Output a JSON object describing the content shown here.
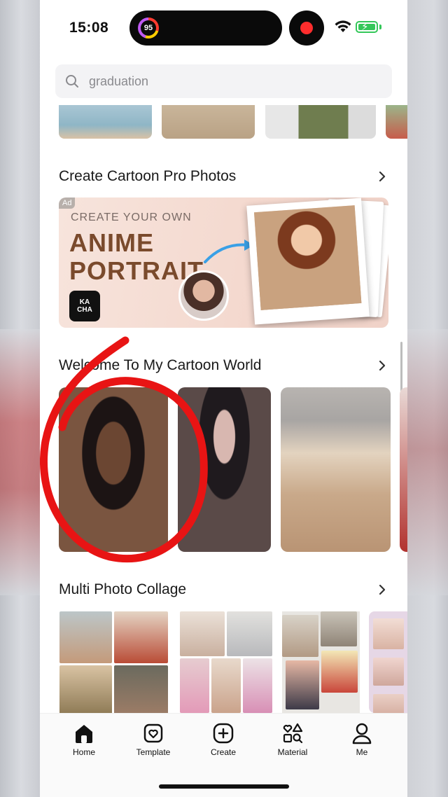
{
  "status": {
    "time": "15:08",
    "activity_badge": "95"
  },
  "search": {
    "query": "graduation"
  },
  "sections": {
    "cartoon_pro": {
      "title": "Create Cartoon Pro Photos"
    },
    "cartoon_world": {
      "title": "Welcome To My Cartoon World"
    },
    "collage": {
      "title": "Multi Photo Collage"
    }
  },
  "banner": {
    "ad_tag": "Ad",
    "line1": "CREATE YOUR OWN",
    "line2": "ANIME",
    "line3": "PORTRAIT",
    "logo_top": "KA",
    "logo_bottom": "CHA"
  },
  "tabs": [
    {
      "label": "Home",
      "icon": "home-icon"
    },
    {
      "label": "Template",
      "icon": "template-icon"
    },
    {
      "label": "Create",
      "icon": "create-icon"
    },
    {
      "label": "Material",
      "icon": "material-icon"
    },
    {
      "label": "Me",
      "icon": "profile-icon"
    }
  ],
  "colors": {
    "accent_red": "#e81414",
    "battery_green": "#34c759"
  }
}
